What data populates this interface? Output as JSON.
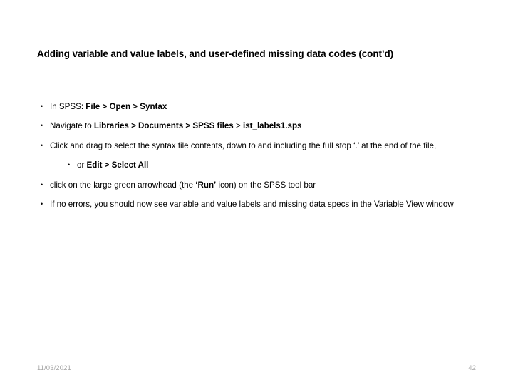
{
  "slide": {
    "title": "Adding variable and value labels, and user-defined missing data codes (cont’d)",
    "background_color": "#ffffff",
    "text_color": "#000000",
    "footer_color": "#a6a6a6"
  },
  "bullets": [
    {
      "level": 1,
      "marker": "•",
      "plain": "In SPSS: File > Open > Syntax",
      "segments": [
        {
          "text": "In SPSS: ",
          "bold": false
        },
        {
          "text": "File > Open > Syntax",
          "bold": true
        }
      ]
    },
    {
      "level": 1,
      "marker": "•",
      "plain": "Navigate to Libraries > Documents > SPSS files > ist_labels1.sps",
      "segments": [
        {
          "text": "Navigate to ",
          "bold": false
        },
        {
          "text": "Libraries > Documents > SPSS files",
          "bold": true
        },
        {
          "text": " > ",
          "bold": false
        },
        {
          "text": "ist_labels1.sps",
          "bold": true
        }
      ]
    },
    {
      "level": 1,
      "marker": "•",
      "plain": "Click and drag to select the syntax file contents, down to and including the full stop ‘.’ at the end of the file,",
      "segments": [
        {
          "text": "Click and drag to select the syntax file contents, down to and including the full stop ‘.’ at the end of the file,",
          "bold": false
        }
      ]
    },
    {
      "level": 2,
      "marker": "•",
      "plain": "or Edit > Select All",
      "segments": [
        {
          "text": "or ",
          "bold": false
        },
        {
          "text": "Edit > Select All",
          "bold": true
        }
      ]
    },
    {
      "level": 1,
      "marker": "•",
      "plain": "click on the large green arrowhead (the ‘Run’ icon) on the SPSS tool bar",
      "segments": [
        {
          "text": "click on the large green arrowhead (the ",
          "bold": false
        },
        {
          "text": "‘Run’",
          "bold": true
        },
        {
          "text": " icon) on the SPSS tool bar",
          "bold": false
        }
      ]
    },
    {
      "level": 1,
      "marker": "•",
      "plain": "If no errors, you should now see variable and value labels and missing data specs in the Variable View window",
      "segments": [
        {
          "text": "If no errors, you should now see variable and value labels and missing data specs in the Variable View window",
          "bold": false
        }
      ]
    }
  ],
  "footer": {
    "date": "11/03/2021",
    "page_number": "42"
  }
}
